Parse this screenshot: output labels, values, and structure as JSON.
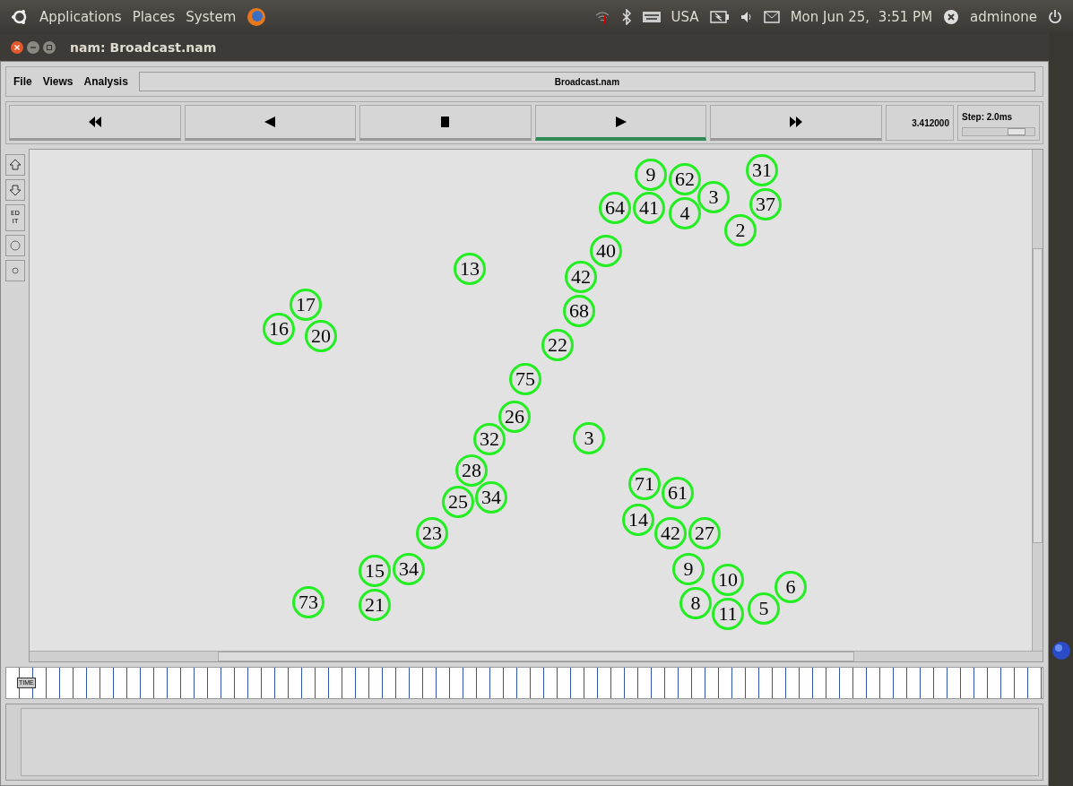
{
  "top_panel": {
    "menus": [
      "Applications",
      "Places",
      "System"
    ],
    "keyboard": "USA",
    "clock": "Mon Jun 25,  3:51 PM",
    "user": "adminone"
  },
  "window": {
    "title": "nam: Broadcast.nam"
  },
  "menu": [
    "File",
    "Views",
    "Analysis"
  ],
  "file_name": "Broadcast.nam",
  "transport": [
    {
      "kind": "rewind",
      "selected": false
    },
    {
      "kind": "back",
      "selected": false
    },
    {
      "kind": "stop",
      "selected": false
    },
    {
      "kind": "play",
      "selected": true
    },
    {
      "kind": "forward",
      "selected": false
    }
  ],
  "time": "3.412000",
  "step": {
    "label": "Step: 2.0ms",
    "level": 0.75
  },
  "edit_tool": [
    "ED",
    "IT"
  ],
  "timeline_label": "TIME",
  "nodes": [
    {
      "label": "9"
    },
    {
      "label": "62"
    },
    {
      "label": "31"
    },
    {
      "label": "3"
    },
    {
      "label": "64"
    },
    {
      "label": "41"
    },
    {
      "label": "4"
    },
    {
      "label": "2"
    },
    {
      "label": "37"
    },
    {
      "label": "40"
    },
    {
      "label": "13"
    },
    {
      "label": "42"
    },
    {
      "label": "17"
    },
    {
      "label": "68"
    },
    {
      "label": "16"
    },
    {
      "label": "20"
    },
    {
      "label": "22"
    },
    {
      "label": "75"
    },
    {
      "label": "26"
    },
    {
      "label": "3"
    },
    {
      "label": "32"
    },
    {
      "label": "28"
    },
    {
      "label": "71"
    },
    {
      "label": "61"
    },
    {
      "label": "25"
    },
    {
      "label": "34"
    },
    {
      "label": "14"
    },
    {
      "label": "23"
    },
    {
      "label": "42"
    },
    {
      "label": "27"
    },
    {
      "label": "15"
    },
    {
      "label": "34"
    },
    {
      "label": "9"
    },
    {
      "label": "10"
    },
    {
      "label": "6"
    },
    {
      "label": "73"
    },
    {
      "label": "21"
    },
    {
      "label": "8"
    },
    {
      "label": "11"
    },
    {
      "label": "5"
    }
  ]
}
